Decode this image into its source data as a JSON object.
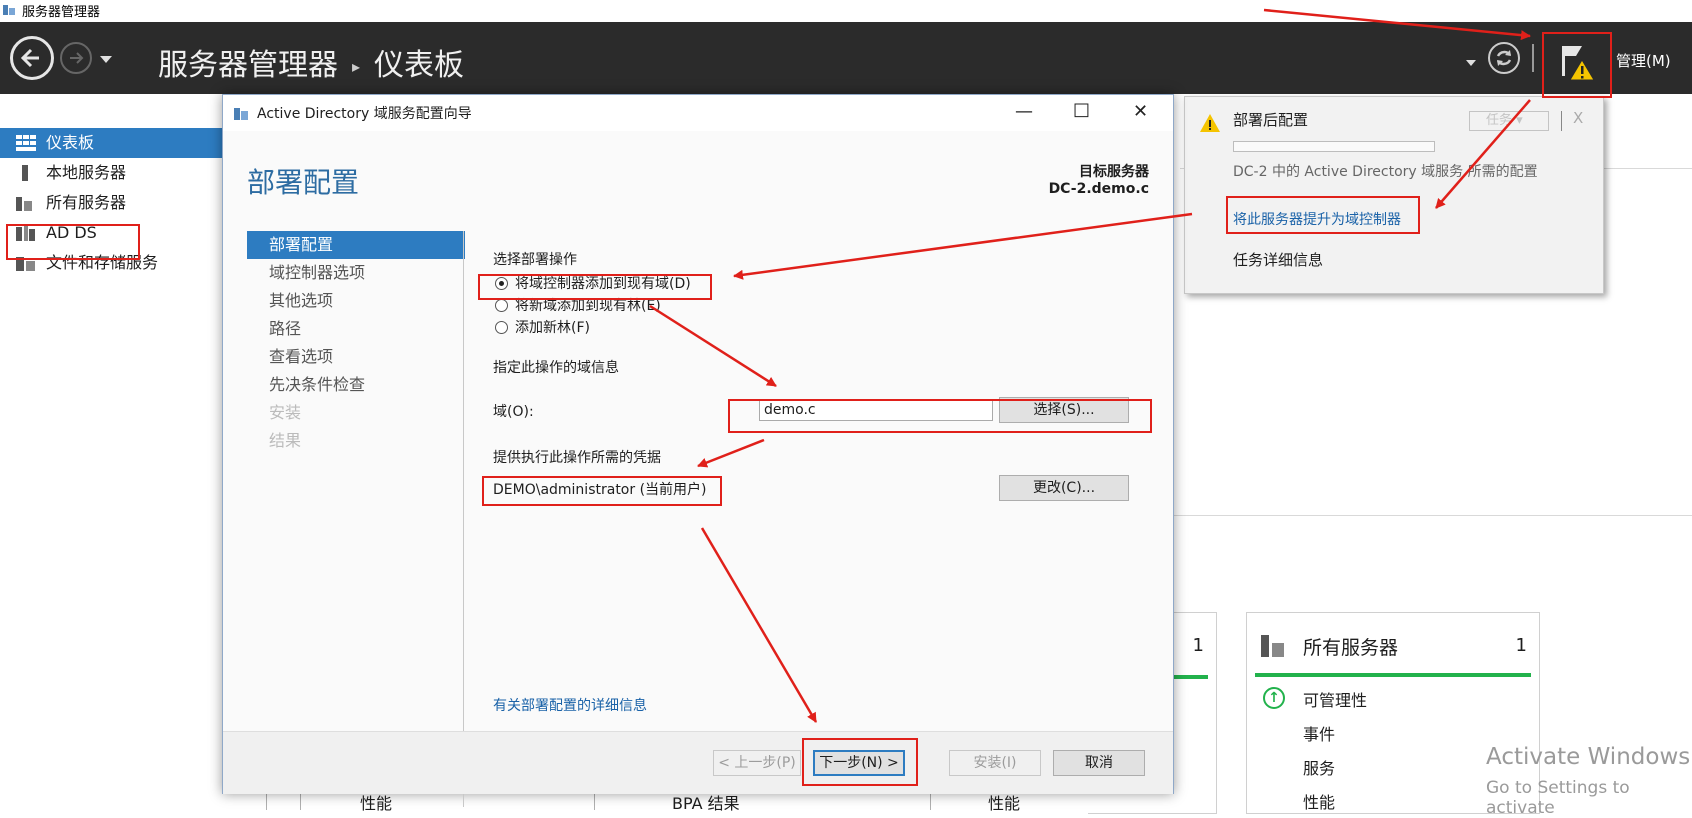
{
  "os": {
    "title": "服务器管理器",
    "app_icon": "server-manager-icon"
  },
  "header": {
    "title": "服务器管理器",
    "separator": "▸",
    "page": "仪表板",
    "manage_label": "管理(M)"
  },
  "sidebar": {
    "items": [
      {
        "label": "仪表板",
        "icon": "dashboard-icon"
      },
      {
        "label": "本地服务器",
        "icon": "server-icon"
      },
      {
        "label": "所有服务器",
        "icon": "servers-icon"
      },
      {
        "label": "AD DS",
        "icon": "adds-icon"
      },
      {
        "label": "文件和存储服务",
        "icon": "storage-icon"
      }
    ]
  },
  "notification": {
    "title": "部署后配置",
    "task_button": "任务",
    "close": "X",
    "description": "DC-2 中的 Active Directory 域服务 所需的配置",
    "link": "将此服务器提升为域控制器",
    "detail": "任务详细信息"
  },
  "wizard": {
    "title": "Active Directory 域服务配置向导",
    "heading": "部署配置",
    "target_label": "目标服务器",
    "target_name": "DC-2.demo.c",
    "steps": [
      {
        "label": "部署配置",
        "state": "active"
      },
      {
        "label": "域控制器选项",
        "state": "normal"
      },
      {
        "label": "其他选项",
        "state": "normal"
      },
      {
        "label": "路径",
        "state": "normal"
      },
      {
        "label": "查看选项",
        "state": "normal"
      },
      {
        "label": "先决条件检查",
        "state": "normal"
      },
      {
        "label": "安装",
        "state": "disabled"
      },
      {
        "label": "结果",
        "state": "disabled"
      }
    ],
    "section_op": "选择部署操作",
    "radios": [
      {
        "label": "将域控制器添加到现有域(D)",
        "checked": true
      },
      {
        "label": "将新域添加到现有林(E)",
        "checked": false
      },
      {
        "label": "添加新林(F)",
        "checked": false
      }
    ],
    "section_domain": "指定此操作的域信息",
    "domain_label": "域(O):",
    "domain_value": "demo.c",
    "select_button": "选择(S)...",
    "section_cred": "提供执行此操作所需的凭据",
    "credential": "DEMO\\administrator (当前用户)",
    "change_button": "更改(C)...",
    "more_link": "有关部署配置的详细信息",
    "buttons": {
      "prev": "< 上一步(P)",
      "next": "下一步(N) >",
      "install": "安装(I)",
      "cancel": "取消"
    }
  },
  "dashboard": {
    "tile_left_count": "1",
    "tile_all_title": "所有服务器",
    "tile_all_count": "1",
    "tile_all_rows": [
      "可管理性",
      "事件",
      "服务",
      "性能"
    ],
    "bottom_labels": [
      "性能",
      "BPA 结果",
      "性能"
    ]
  },
  "watermark": {
    "line1": "Activate Windows",
    "line2": "Go to Settings to activate"
  },
  "colors": {
    "header_bg": "#2b2b2b",
    "accent": "#2d7cc1",
    "annotation": "#e0201a",
    "ok_green": "#22b24c"
  }
}
